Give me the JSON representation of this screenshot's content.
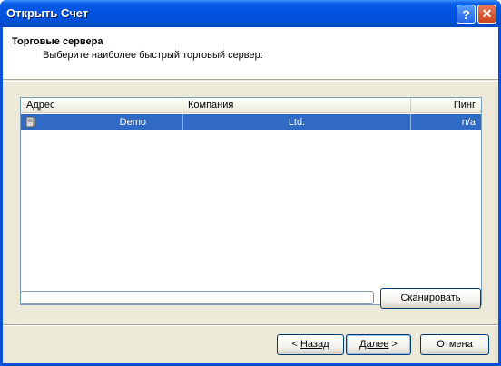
{
  "window": {
    "title": "Открыть Счет",
    "help_glyph": "?",
    "close_glyph": "✕"
  },
  "header": {
    "title": "Торговые сервера",
    "subtitle": "Выберите наиболее быстрый торговый сервер:"
  },
  "server_list": {
    "columns": [
      "Адрес",
      "Компания",
      "Пинг"
    ],
    "rows": [
      {
        "address": "Demo",
        "company": "Ltd.",
        "ping": "n/a",
        "selected": true,
        "icon": "server-icon"
      }
    ]
  },
  "progress": {
    "value": 0
  },
  "buttons": {
    "scan_label": "Сканировать",
    "back_arrow": "< ",
    "back_label": "Назад",
    "next_label": "Далее",
    "next_arrow": " >",
    "cancel_label": "Отмена"
  },
  "colors": {
    "titlebar": "#0054e3",
    "selection": "#316ac5",
    "dialog_bg": "#ece9d8"
  }
}
